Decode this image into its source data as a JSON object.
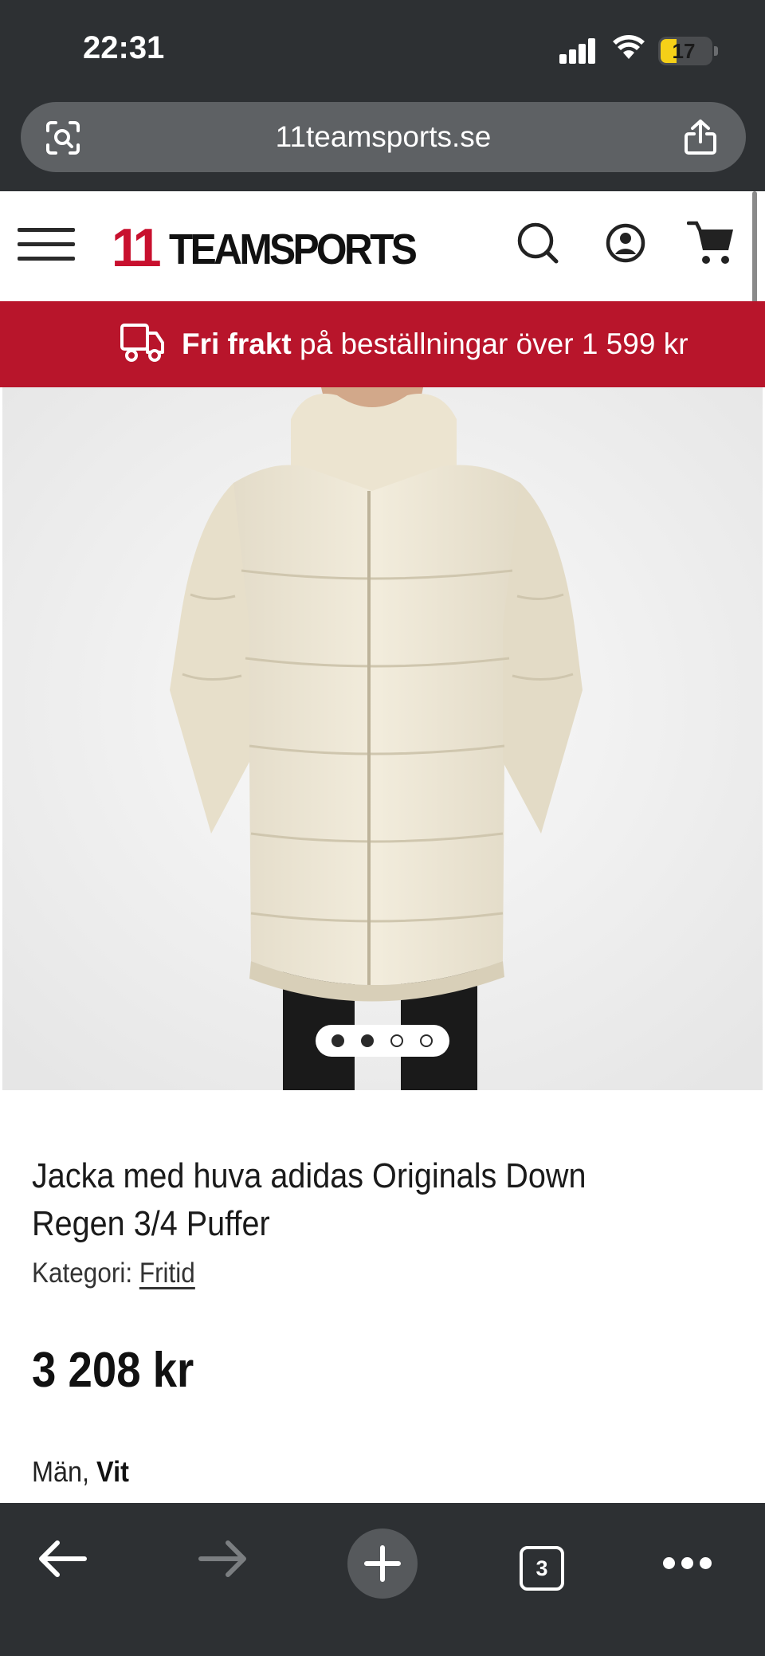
{
  "status_bar": {
    "time": "22:31",
    "battery_level": "17"
  },
  "browser": {
    "url": "11teamsports.se",
    "open_tabs": "3"
  },
  "header": {
    "logo_number": "11",
    "logo_word": "TEAMSPORTS",
    "icons": [
      "menu-icon",
      "search-icon",
      "account-icon",
      "cart-icon"
    ]
  },
  "promo": {
    "bold": "Fri frakt",
    "rest": " på beställningar över 1 599 kr",
    "icon": "delivery-truck-icon"
  },
  "product": {
    "image_slides": 4,
    "image_active_slides": [
      1,
      2
    ],
    "title": "Jacka med huva adidas Originals Down Regen 3/4 Puffer",
    "category_label": "Kategori: ",
    "category_value": "Fritid",
    "price": "3 208 kr",
    "gender": "Män, ",
    "color": "Vit"
  },
  "colors": {
    "brand_red": "#b8152b",
    "chrome_dark": "#2d3033",
    "url_bar": "#5e6164",
    "jacket_cream": "#ede6d3"
  }
}
